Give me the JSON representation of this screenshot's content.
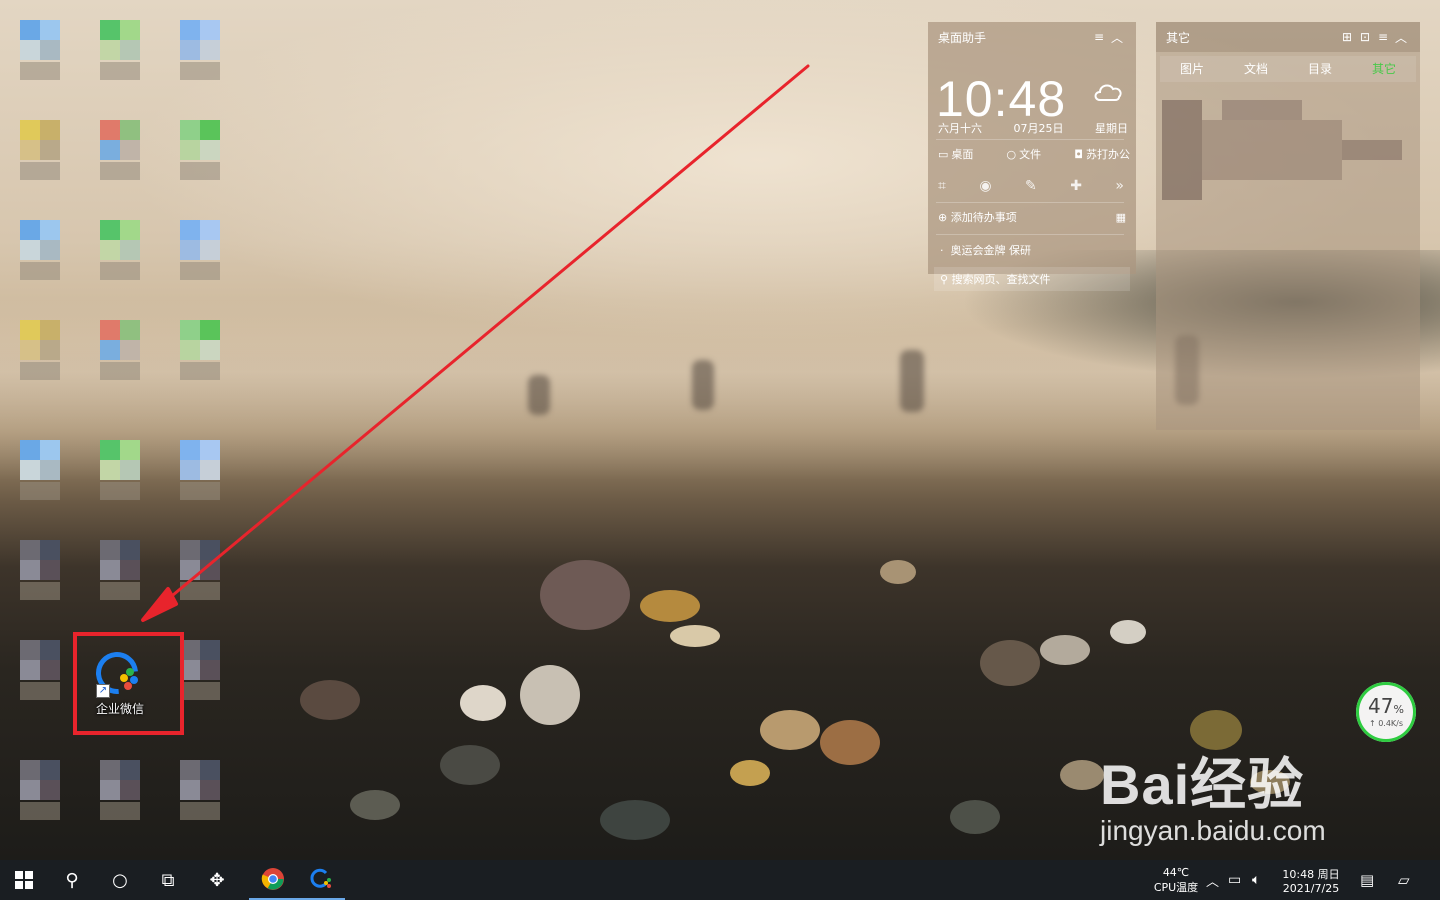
{
  "desktop": {
    "app_label": "企业微信",
    "app_icon": "wecom-icon"
  },
  "assistant_widget": {
    "title": "桌面助手",
    "time": "10:48",
    "lunar_date": "六月十六",
    "date": "07月25日",
    "weekday": "星期日",
    "quick_links": [
      {
        "label": "桌面",
        "icon": "monitor-icon"
      },
      {
        "label": "文件",
        "icon": "search-icon"
      },
      {
        "label": "苏打办公",
        "icon": "office-icon"
      }
    ],
    "add_todo": "添加待办事项",
    "news": "奥运会金牌 保研",
    "search_placeholder": "搜索网页、查找文件"
  },
  "other_widget": {
    "title": "其它",
    "tabs": [
      "图片",
      "文档",
      "目录",
      "其它"
    ],
    "active_tab": "其它"
  },
  "network_meter": {
    "percent": "47",
    "percent_unit": "%",
    "speed": "0.4K/s"
  },
  "watermark": {
    "brand": "Bai经验",
    "url": "jingyan.baidu.com"
  },
  "taskbar": {
    "cpu_temp": "44℃",
    "cpu_label": "CPU温度",
    "clock_time": "10:48 周日",
    "clock_date": "2021/7/25"
  },
  "colors": {
    "highlight": "#e8242c",
    "active_tab": "#49c94a",
    "taskbar": "#1a1e22"
  }
}
